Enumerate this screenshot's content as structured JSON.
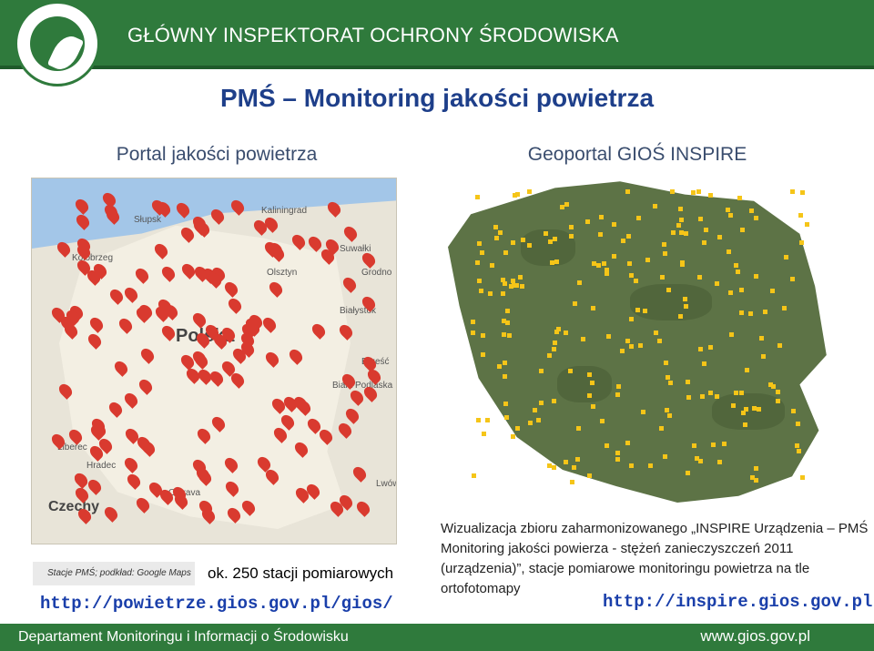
{
  "header": {
    "organization": "GŁÓWNY INSPEKTORAT OCHRONY ŚRODOWISKA"
  },
  "main_title": "PMŚ – Monitoring jakości powietrza",
  "left_panel": {
    "subtitle": "Portal jakości powietrza",
    "map_labels": [
      "Słupsk",
      "Kaliningrad",
      "Suwałki",
      "Kołobrzeg",
      "Olsztyn",
      "Grodno",
      "Białystok",
      "Polska",
      "Brześć",
      "Biała Podlaska",
      "Liberec",
      "Hradec",
      "Czechy",
      "Ostrava",
      "Lwów"
    ],
    "legend_note": "Stacje PMŚ; podkład: Google Maps",
    "station_count": "ok. 250 stacji pomiarowych",
    "url": "http://powietrze.gios.gov.pl/gios/"
  },
  "right_panel": {
    "subtitle": "Geoportal GIOŚ INSPIRE",
    "description": "Wizualizacja zbioru zaharmonizowanego „INSPIRE Urządzenia – PMŚ Monitoring jakości powierza - stężeń zanieczyszczeń 2011 (urządzenia)”, stacje pomiarowe monitoringu powietrza na tle ortofotomapy",
    "url": "http://inspire.gios.gov.pl"
  },
  "footer": {
    "department": "Departament Monitoringu i Informacji o Środowisku",
    "website": "www.gios.gov.pl"
  },
  "colors": {
    "brand_green": "#2f7a3c",
    "title_blue": "#1e3f8a",
    "link_blue": "#1a3faa",
    "marker_red": "#d93a2f",
    "marker_yellow": "#f5c518"
  }
}
